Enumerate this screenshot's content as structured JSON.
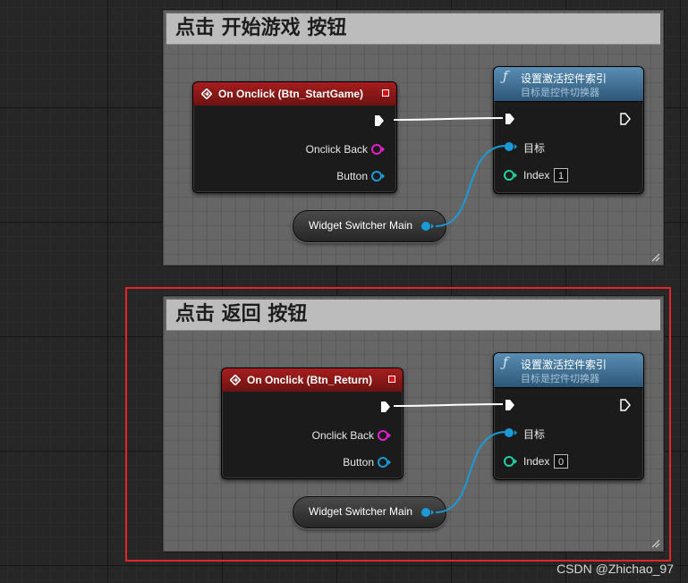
{
  "comments": [
    {
      "title": "点击 开始游戏 按钮",
      "event_node": {
        "title": "On Onclick (Btn_StartGame)",
        "pins": [
          "Onclick Back",
          "Button"
        ]
      },
      "function_node": {
        "title": "设置激活控件索引",
        "subtitle": "目标是控件切换器",
        "target_label": "目标",
        "index_label": "Index",
        "index_value": "1"
      },
      "variable_node": {
        "label": "Widget Switcher Main"
      }
    },
    {
      "title": "点击 返回 按钮",
      "highlighted": true,
      "event_node": {
        "title": "On Onclick (Btn_Return)",
        "pins": [
          "Onclick Back",
          "Button"
        ]
      },
      "function_node": {
        "title": "设置激活控件索引",
        "subtitle": "目标是控件切换器",
        "target_label": "目标",
        "index_label": "Index",
        "index_value": "0"
      },
      "variable_node": {
        "label": "Widget Switcher Main"
      }
    }
  ],
  "watermark": "CSDN @Zhichao_97",
  "colors": {
    "event_header": "#8b1a1a",
    "function_header": "#3f6f93",
    "exec_wire": "#ffffff",
    "object_pin": "#1a9bd7",
    "delegate_pin": "#e020c8",
    "int_pin": "#1fd0a0",
    "highlight_border": "#e62424"
  }
}
